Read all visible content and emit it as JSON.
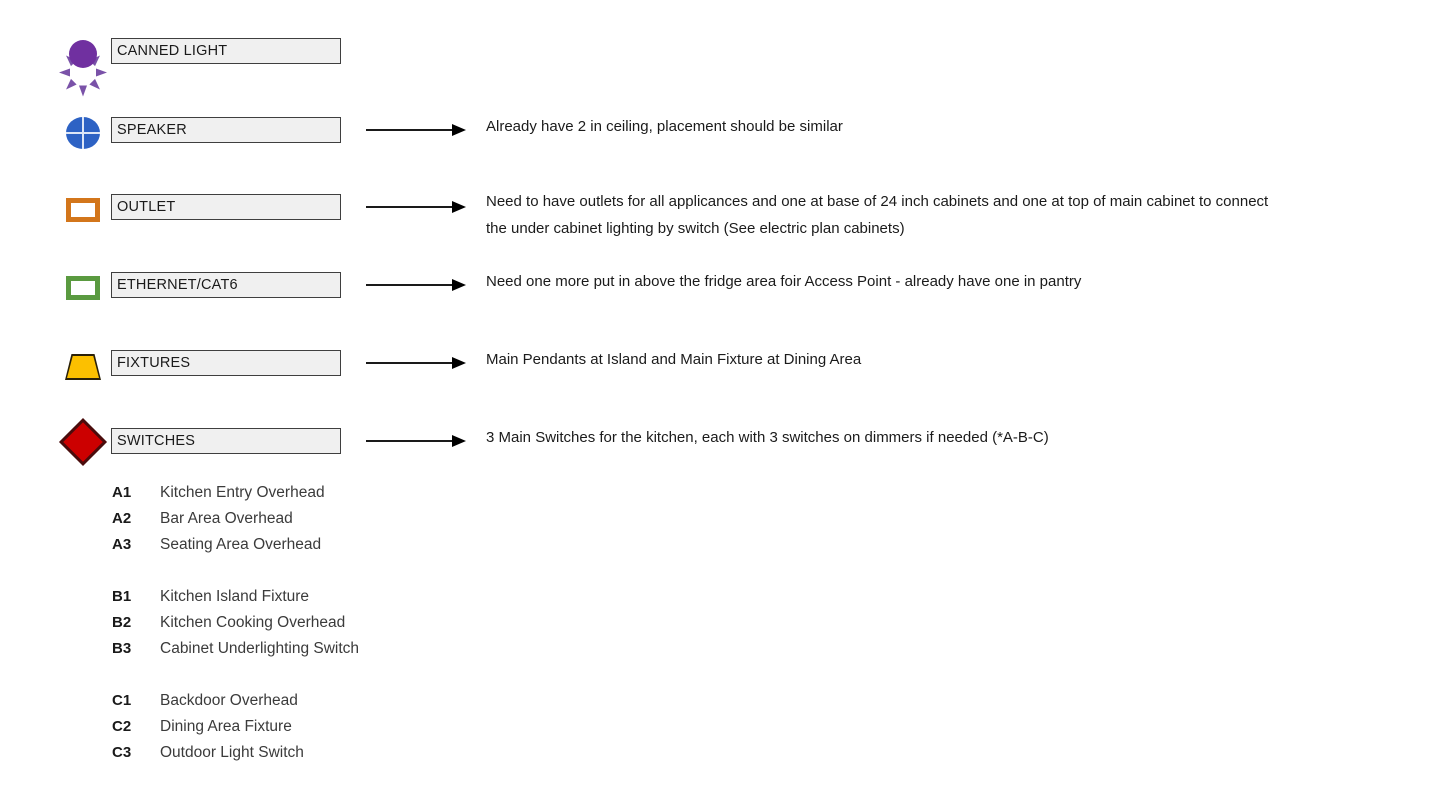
{
  "legend": {
    "rows": [
      {
        "symbol": "canned-light-symbol",
        "label": "CANNED LIGHT",
        "color": "#7030a0",
        "note_lines": [],
        "has_arrow": false
      },
      {
        "symbol": "speaker-symbol",
        "label": "SPEAKER",
        "color": "#2d62c4",
        "note_lines": [
          "Already have 2 in ceiling, placement should be similar"
        ],
        "has_arrow": true
      },
      {
        "symbol": "outlet-symbol",
        "label": "OUTLET",
        "color": "#d3761b",
        "note_lines": [
          "Need to have outlets for all applicances and one at base of 24 inch cabinets and one at top of main cabinet to connect",
          "the under cabinet lighting by switch (See electric plan cabinets)"
        ],
        "has_arrow": true
      },
      {
        "symbol": "ethernet-symbol",
        "label": "ETHERNET/CAT6",
        "color": "#5a9a40",
        "note_lines": [
          "Need one more put in above the fridge area foir Access Point -  already have one in pantry"
        ],
        "has_arrow": true
      },
      {
        "symbol": "fixtures-symbol",
        "label": "FIXTURES",
        "color": "#fcc000",
        "note_lines": [
          "Main Pendants at Island and Main Fixture at Dining Area"
        ],
        "has_arrow": true
      },
      {
        "symbol": "switches-symbol",
        "label": "SWITCHES",
        "color": "#cc0000",
        "note_lines": [
          "3 Main Switches for the kitchen, each with 3 switches on dimmers if needed (*A-B-C)"
        ],
        "has_arrow": true
      }
    ]
  },
  "switch_schedule": {
    "groups": [
      {
        "group": "A",
        "items": [
          {
            "code": "A1",
            "description": "Kitchen Entry Overhead"
          },
          {
            "code": "A2",
            "description": "Bar Area Overhead"
          },
          {
            "code": "A3",
            "description": "Seating Area Overhead"
          }
        ]
      },
      {
        "group": "B",
        "items": [
          {
            "code": "B1",
            "description": "Kitchen Island Fixture"
          },
          {
            "code": "B2",
            "description": "Kitchen Cooking Overhead"
          },
          {
            "code": "B3",
            "description": "Cabinet Underlighting Switch"
          }
        ]
      },
      {
        "group": "C",
        "items": [
          {
            "code": "C1",
            "description": "Backdoor Overhead"
          },
          {
            "code": "C2",
            "description": "Dining Area Fixture"
          },
          {
            "code": "C3",
            "description": "Outdoor Light Switch"
          }
        ]
      }
    ]
  }
}
